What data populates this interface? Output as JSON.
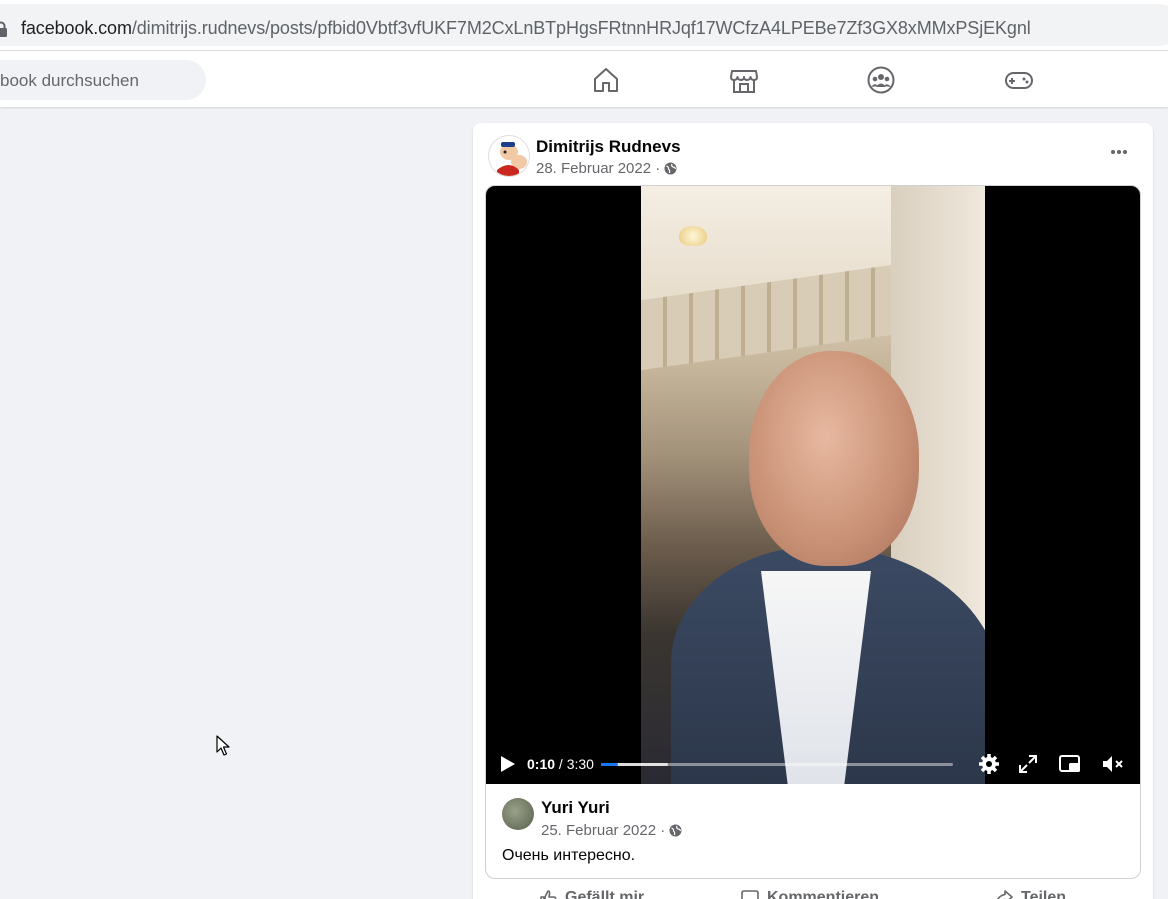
{
  "browser": {
    "url_host": "facebook.com",
    "url_path": "/dimitrijs.rudnevs/posts/pfbid0Vbtf3vfUKF7M2CxLnBTpHgsFRtnnHRJqf17WCfzA4LPEBe7Zf3GX8xMMxPSjEKgnl"
  },
  "header": {
    "search_placeholder": "book durchsuchen",
    "nav": [
      "home-icon",
      "marketplace-icon",
      "groups-icon",
      "gaming-icon"
    ]
  },
  "post": {
    "author": "Dimitrijs Rudnevs",
    "date": "28. Februar 2022 ·",
    "more_label": "···",
    "video": {
      "current_time": "0:10",
      "total_time": "/ 3:30",
      "progress_fraction": 0.048,
      "buffered_fraction": 0.19
    },
    "shared": {
      "author": "Yuri Yuri",
      "date": "25. Februar 2022 ·",
      "text": "Очень интересно."
    },
    "actions": {
      "like": "Gefällt mir",
      "comment": "Kommentieren",
      "share": "Teilen"
    }
  },
  "colors": {
    "accent": "#1877f2",
    "background": "#f0f2f5"
  }
}
